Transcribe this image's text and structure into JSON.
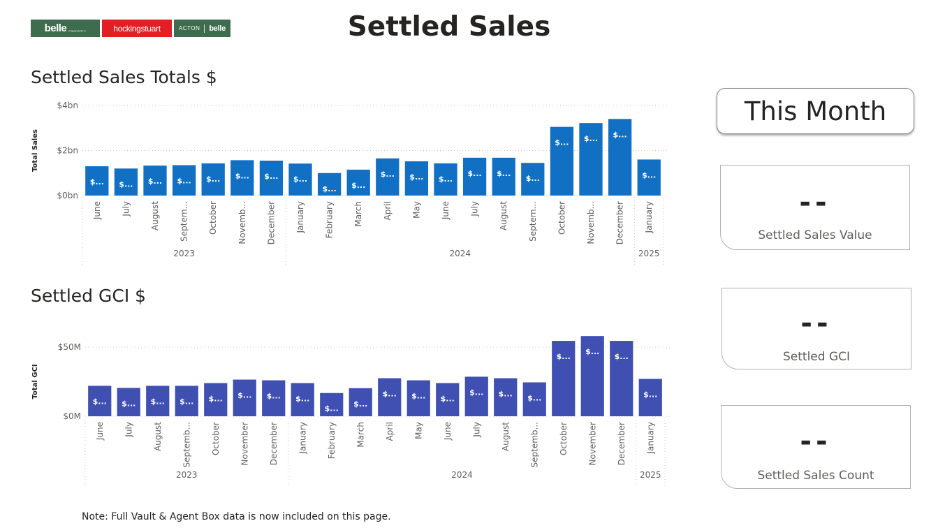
{
  "header": {
    "title": "Settled Sales",
    "logos": {
      "belle": {
        "main": "belle",
        "sub": "PROPERTY"
      },
      "hockingstuart": "hockingstuart",
      "acton_belle": {
        "acton": "ACTON",
        "belle": "belle"
      }
    }
  },
  "colors": {
    "sales_bar": "#1170c4",
    "gci_bar": "#3f4fb2"
  },
  "sections": {
    "sales_title": "Settled Sales Totals $",
    "gci_title": "Settled GCI $"
  },
  "this_month": {
    "label": "This Month"
  },
  "cards": [
    {
      "value": "--",
      "label": "Settled Sales Value"
    },
    {
      "value": "--",
      "label": "Settled GCI"
    },
    {
      "value": "--",
      "label": "Settled Sales Count"
    }
  ],
  "note": "Note: Full Vault & Agent Box data is now included on this page.",
  "chart_data": [
    {
      "type": "bar",
      "title": "Settled Sales Totals $",
      "ylabel": "Total Sales",
      "xlabel": "",
      "ylim": [
        0,
        4
      ],
      "y_unit": "bn",
      "yticks": [
        {
          "value": 0,
          "label": "$0bn"
        },
        {
          "value": 2,
          "label": "$2bn"
        },
        {
          "value": 4,
          "label": "$4bn"
        }
      ],
      "grid": true,
      "categories": [
        "June",
        "July",
        "August",
        "Septem...",
        "October",
        "Novemb...",
        "December",
        "January",
        "February",
        "March",
        "April",
        "May",
        "June",
        "July",
        "August",
        "Septem...",
        "October",
        "Novemb...",
        "December",
        "January"
      ],
      "years": [
        {
          "label": "2023",
          "start": 0,
          "end": 6
        },
        {
          "label": "2024",
          "start": 7,
          "end": 18
        },
        {
          "label": "2025",
          "start": 19,
          "end": 19
        }
      ],
      "values": [
        1.3,
        1.2,
        1.33,
        1.35,
        1.43,
        1.57,
        1.55,
        1.42,
        1.0,
        1.15,
        1.65,
        1.52,
        1.43,
        1.68,
        1.68,
        1.45,
        3.05,
        3.22,
        3.4,
        1.6
      ],
      "data_labels": [
        "$...",
        "$...",
        "$...",
        "$...",
        "$...",
        "$...",
        "$...",
        "$...",
        "$...",
        "$...",
        "$...",
        "$...",
        "$...",
        "$...",
        "$...",
        "$...",
        "$...",
        "$...",
        "$...",
        "$..."
      ]
    },
    {
      "type": "bar",
      "title": "Settled GCI $",
      "ylabel": "Total GCI",
      "xlabel": "",
      "ylim": [
        0,
        50
      ],
      "y_unit": "M",
      "yticks": [
        {
          "value": 0,
          "label": "$0M"
        },
        {
          "value": 50,
          "label": "$50M"
        }
      ],
      "grid": true,
      "categories": [
        "June",
        "July",
        "August",
        "Septemb...",
        "October",
        "November",
        "December",
        "January",
        "February",
        "March",
        "April",
        "May",
        "June",
        "July",
        "August",
        "Septemb...",
        "October",
        "November",
        "December",
        "January"
      ],
      "years": [
        {
          "label": "2023",
          "start": 0,
          "end": 6
        },
        {
          "label": "2024",
          "start": 7,
          "end": 18
        },
        {
          "label": "2025",
          "start": 19,
          "end": 19
        }
      ],
      "values": [
        22,
        20.5,
        22,
        22,
        24,
        26.5,
        26,
        24,
        16.8,
        20.3,
        27.5,
        26,
        24,
        28.6,
        27.5,
        24.5,
        54.5,
        58,
        54.5,
        27
      ],
      "data_labels": [
        "$...",
        "$...",
        "$...",
        "$...",
        "$...",
        "$...",
        "$...",
        "$...",
        "$...",
        "$...",
        "$...",
        "$...",
        "$...",
        "$...",
        "$...",
        "$...",
        "$...",
        "$...",
        "$...",
        "$..."
      ]
    }
  ]
}
